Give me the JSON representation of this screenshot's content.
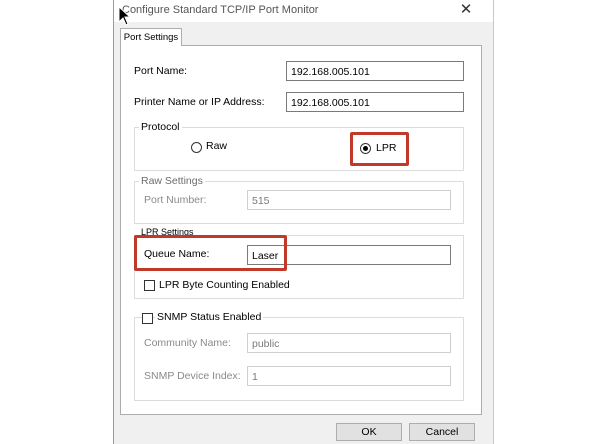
{
  "window": {
    "title": "Configure Standard TCP/IP Port Monitor"
  },
  "tab": {
    "label": "Port Settings"
  },
  "port_name": {
    "label": "Port Name:",
    "value": "192.168.005.101"
  },
  "printer_name": {
    "label": "Printer Name or IP Address:",
    "value": "192.168.005.101"
  },
  "protocol": {
    "label": "Protocol",
    "raw": "Raw",
    "lpr": "LPR",
    "selected": "LPR"
  },
  "raw_settings": {
    "label": "Raw Settings",
    "port_number_label": "Port Number:",
    "port_number_value": "515"
  },
  "lpr_settings": {
    "label": "LPR Settings",
    "queue_name_label": "Queue Name:",
    "queue_name_value": "Laser",
    "byte_counting_label": "LPR Byte Counting Enabled",
    "byte_counting_checked": false
  },
  "snmp": {
    "label": "SNMP Status Enabled",
    "checked": false,
    "community_label": "Community Name:",
    "community_value": "public",
    "index_label": "SNMP Device Index:",
    "index_value": "1"
  },
  "buttons": {
    "ok": "OK",
    "cancel": "Cancel"
  },
  "highlight_color": "#c0392b"
}
